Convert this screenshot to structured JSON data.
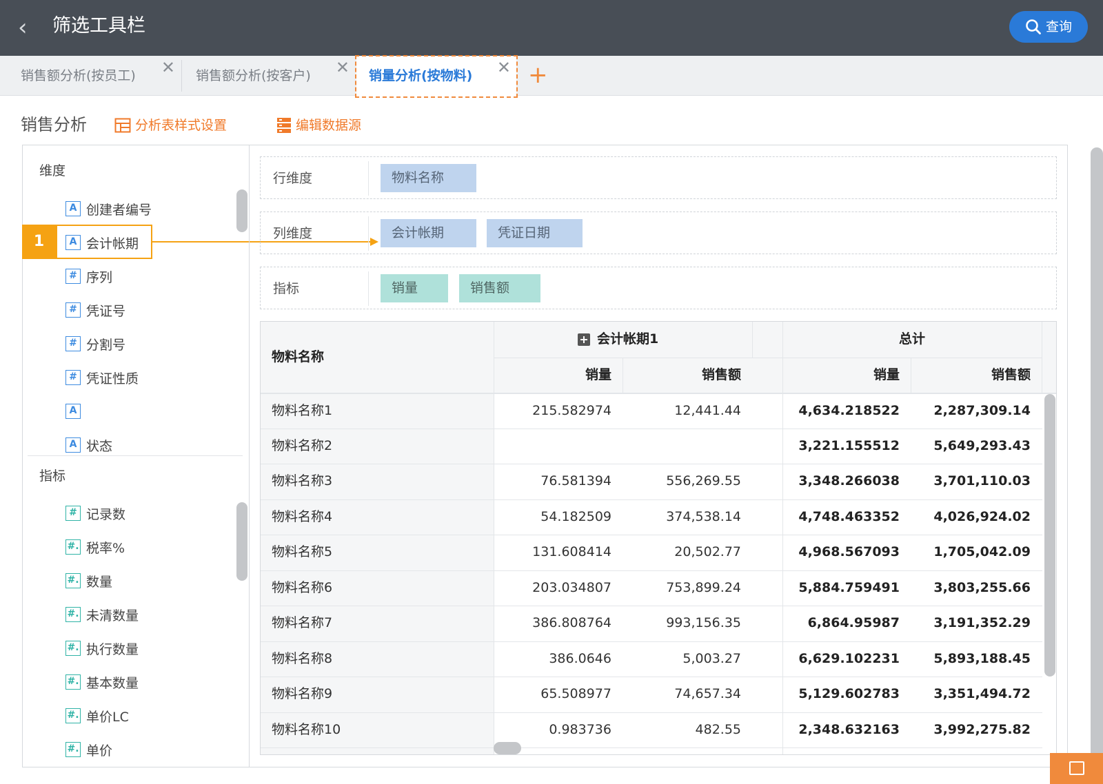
{
  "header": {
    "title": "筛选工具栏",
    "query_label": "查询",
    "accent": "#2a7ad8",
    "bg": "#484e56"
  },
  "tabs": [
    {
      "label": "销售额分析(按员工)",
      "active": false
    },
    {
      "label": "销售额分析(按客户)",
      "active": false
    },
    {
      "label": "销量分析(按物料)",
      "active": true
    }
  ],
  "add_tab_icon": "plus-icon",
  "toolbar": {
    "section_title": "销售分析",
    "style_settings": "分析表样式设置",
    "edit_source": "编辑数据源",
    "tool_color": "#f07a2a"
  },
  "field_panel": {
    "dimensions_title": "维度",
    "dimensions": [
      {
        "type": "A",
        "label": "创建者编号"
      },
      {
        "type": "A",
        "label": "会计帐期"
      },
      {
        "type": "#",
        "label": "序列"
      },
      {
        "type": "#",
        "label": "凭证号"
      },
      {
        "type": "#",
        "label": "分割号"
      },
      {
        "type": "#",
        "label": "凭证性质"
      },
      {
        "type": "A",
        "label": ""
      },
      {
        "type": "A",
        "label": "状态"
      }
    ],
    "measures_title": "指标",
    "measures": [
      {
        "type": "#",
        "label": "记录数"
      },
      {
        "type": "#.",
        "label": "税率%"
      },
      {
        "type": "#.",
        "label": "数量"
      },
      {
        "type": "#.",
        "label": "未清数量"
      },
      {
        "type": "#.",
        "label": "执行数量"
      },
      {
        "type": "#.",
        "label": "基本数量"
      },
      {
        "type": "#.",
        "label": "单价LC"
      },
      {
        "type": "#.",
        "label": "单价"
      }
    ]
  },
  "callout": {
    "number": "1",
    "color": "#f5a213"
  },
  "zones": {
    "row": {
      "label": "行维度",
      "chips": [
        "物料名称"
      ]
    },
    "col": {
      "label": "列维度",
      "chips": [
        "会计帐期",
        "凭证日期"
      ]
    },
    "measure": {
      "label": "指标",
      "chips": [
        "销量",
        "销售额"
      ]
    }
  },
  "table": {
    "row_header": "物料名称",
    "group1": "会计帐期1",
    "total": "总计",
    "sub_headers": [
      "销量",
      "销售额",
      "销量",
      "销售额"
    ],
    "rows": [
      [
        "物料名称1",
        "215.582974",
        "12,441.44",
        "4,634.218522",
        "2,287,309.14"
      ],
      [
        "物料名称2",
        "",
        "",
        "3,221.155512",
        "5,649,293.43"
      ],
      [
        "物料名称3",
        "76.581394",
        "556,269.55",
        "3,348.266038",
        "3,701,110.03"
      ],
      [
        "物料名称4",
        "54.182509",
        "374,538.14",
        "4,748.463352",
        "4,026,924.02"
      ],
      [
        "物料名称5",
        "131.608414",
        "20,502.77",
        "4,968.567093",
        "1,705,042.09"
      ],
      [
        "物料名称6",
        "203.034807",
        "753,899.24",
        "5,884.759491",
        "3,803,255.66"
      ],
      [
        "物料名称7",
        "386.808764",
        "993,156.35",
        "6,864.95987",
        "3,191,352.29"
      ],
      [
        "物料名称8",
        "386.0646",
        "5,003.27",
        "6,629.102231",
        "5,893,188.45"
      ],
      [
        "物料名称9",
        "65.508977",
        "74,657.34",
        "5,129.602783",
        "3,351,494.72"
      ],
      [
        "物料名称10",
        "0.983736",
        "482.55",
        "2,348.632163",
        "3,992,275.82"
      ]
    ]
  }
}
